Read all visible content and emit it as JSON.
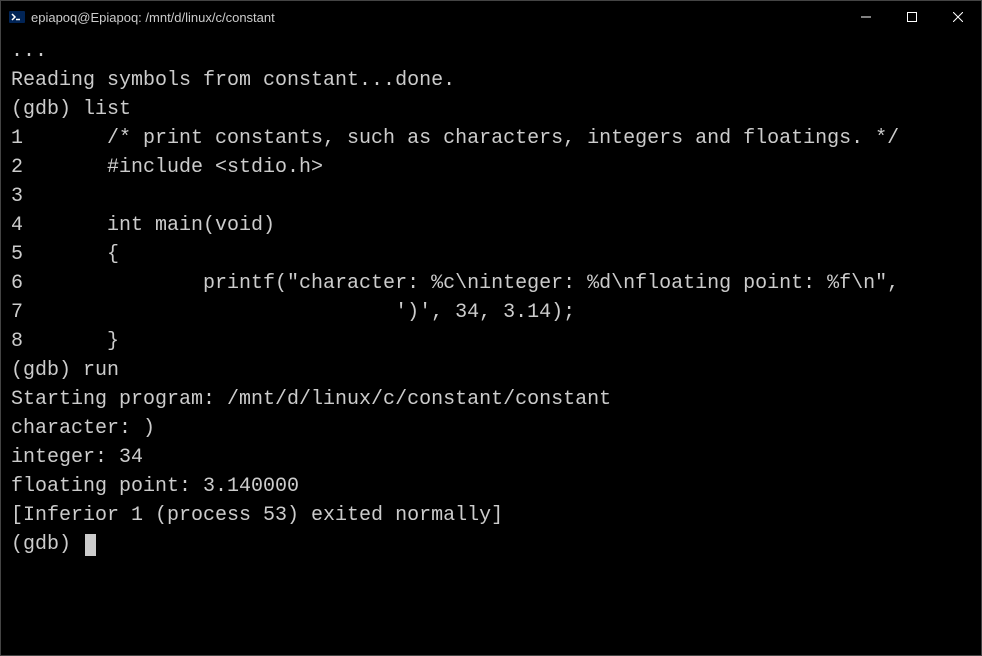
{
  "window": {
    "title": "epiapoq@Epiapoq: /mnt/d/linux/c/constant"
  },
  "terminal": {
    "lines": [
      "...",
      "Reading symbols from constant...done.",
      "(gdb) list",
      "1       /* print constants, such as characters, integers and floatings. */",
      "2       #include <stdio.h>",
      "3",
      "4       int main(void)",
      "5       {",
      "6               printf(\"character: %c\\ninteger: %d\\nfloating point: %f\\n\",",
      "7                               ')', 34, 3.14);",
      "8       }",
      "(gdb) run",
      "Starting program: /mnt/d/linux/c/constant/constant",
      "character: )",
      "integer: 34",
      "floating point: 3.140000",
      "[Inferior 1 (process 53) exited normally]",
      "(gdb) "
    ]
  }
}
